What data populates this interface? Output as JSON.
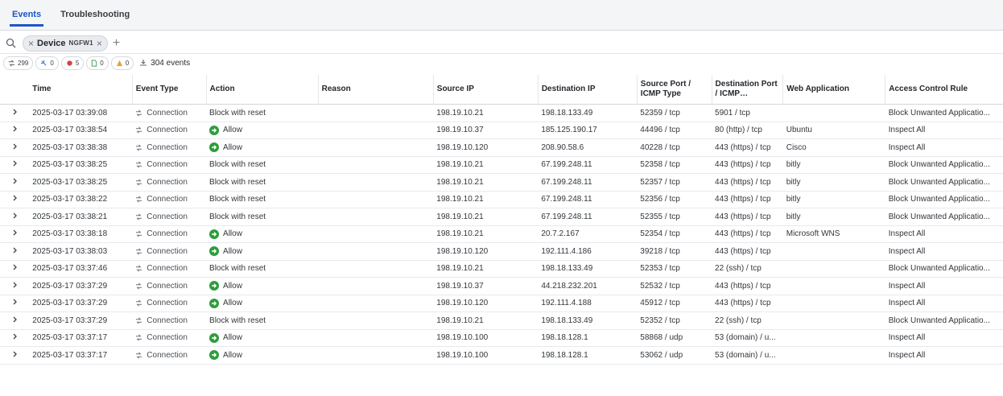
{
  "tabs": [
    {
      "label": "Events",
      "active": true
    },
    {
      "label": "Troubleshooting",
      "active": false
    }
  ],
  "filter": {
    "search_icon": "search-icon",
    "chip_key": "Device",
    "chip_value": "NGFW1",
    "add_icon": "plus-icon"
  },
  "counts": {
    "connection": "299",
    "intrusion": "0",
    "malware": "5",
    "file": "0",
    "security_intel": "0",
    "total": "304 events"
  },
  "columns": [
    "Time",
    "Event Type",
    "Action",
    "Reason",
    "Source IP",
    "Destination IP",
    "Source Port / ICMP Type",
    "Destination Port / ICMP…",
    "Web Application",
    "Access Control Rule"
  ],
  "rows": [
    {
      "time": "2025-03-17 03:39:08",
      "type": "Connection",
      "action": "Block with reset",
      "reason": "",
      "src": "198.19.10.21",
      "dst": "198.18.133.49",
      "sport": "52359 / tcp",
      "dport": "5901 / tcp",
      "app": "",
      "rule": "Block Unwanted Applicatio..."
    },
    {
      "time": "2025-03-17 03:38:54",
      "type": "Connection",
      "action": "Allow",
      "reason": "",
      "src": "198.19.10.37",
      "dst": "185.125.190.17",
      "sport": "44496 / tcp",
      "dport": "80 (http) / tcp",
      "app": "Ubuntu",
      "rule": "Inspect All"
    },
    {
      "time": "2025-03-17 03:38:38",
      "type": "Connection",
      "action": "Allow",
      "reason": "",
      "src": "198.19.10.120",
      "dst": "208.90.58.6",
      "sport": "40228 / tcp",
      "dport": "443 (https) / tcp",
      "app": "Cisco",
      "rule": "Inspect All"
    },
    {
      "time": "2025-03-17 03:38:25",
      "type": "Connection",
      "action": "Block with reset",
      "reason": "",
      "src": "198.19.10.21",
      "dst": "67.199.248.11",
      "sport": "52358 / tcp",
      "dport": "443 (https) / tcp",
      "app": "bitly",
      "rule": "Block Unwanted Applicatio..."
    },
    {
      "time": "2025-03-17 03:38:25",
      "type": "Connection",
      "action": "Block with reset",
      "reason": "",
      "src": "198.19.10.21",
      "dst": "67.199.248.11",
      "sport": "52357 / tcp",
      "dport": "443 (https) / tcp",
      "app": "bitly",
      "rule": "Block Unwanted Applicatio..."
    },
    {
      "time": "2025-03-17 03:38:22",
      "type": "Connection",
      "action": "Block with reset",
      "reason": "",
      "src": "198.19.10.21",
      "dst": "67.199.248.11",
      "sport": "52356 / tcp",
      "dport": "443 (https) / tcp",
      "app": "bitly",
      "rule": "Block Unwanted Applicatio..."
    },
    {
      "time": "2025-03-17 03:38:21",
      "type": "Connection",
      "action": "Block with reset",
      "reason": "",
      "src": "198.19.10.21",
      "dst": "67.199.248.11",
      "sport": "52355 / tcp",
      "dport": "443 (https) / tcp",
      "app": "bitly",
      "rule": "Block Unwanted Applicatio..."
    },
    {
      "time": "2025-03-17 03:38:18",
      "type": "Connection",
      "action": "Allow",
      "reason": "",
      "src": "198.19.10.21",
      "dst": "20.7.2.167",
      "sport": "52354 / tcp",
      "dport": "443 (https) / tcp",
      "app": "Microsoft WNS",
      "rule": "Inspect All"
    },
    {
      "time": "2025-03-17 03:38:03",
      "type": "Connection",
      "action": "Allow",
      "reason": "",
      "src": "198.19.10.120",
      "dst": "192.111.4.186",
      "sport": "39218 / tcp",
      "dport": "443 (https) / tcp",
      "app": "",
      "rule": "Inspect All"
    },
    {
      "time": "2025-03-17 03:37:46",
      "type": "Connection",
      "action": "Block with reset",
      "reason": "",
      "src": "198.19.10.21",
      "dst": "198.18.133.49",
      "sport": "52353 / tcp",
      "dport": "22 (ssh) / tcp",
      "app": "",
      "rule": "Block Unwanted Applicatio..."
    },
    {
      "time": "2025-03-17 03:37:29",
      "type": "Connection",
      "action": "Allow",
      "reason": "",
      "src": "198.19.10.37",
      "dst": "44.218.232.201",
      "sport": "52532 / tcp",
      "dport": "443 (https) / tcp",
      "app": "",
      "rule": "Inspect All"
    },
    {
      "time": "2025-03-17 03:37:29",
      "type": "Connection",
      "action": "Allow",
      "reason": "",
      "src": "198.19.10.120",
      "dst": "192.111.4.188",
      "sport": "45912 / tcp",
      "dport": "443 (https) / tcp",
      "app": "",
      "rule": "Inspect All"
    },
    {
      "time": "2025-03-17 03:37:29",
      "type": "Connection",
      "action": "Block with reset",
      "reason": "",
      "src": "198.19.10.21",
      "dst": "198.18.133.49",
      "sport": "52352 / tcp",
      "dport": "22 (ssh) / tcp",
      "app": "",
      "rule": "Block Unwanted Applicatio..."
    },
    {
      "time": "2025-03-17 03:37:17",
      "type": "Connection",
      "action": "Allow",
      "reason": "",
      "src": "198.19.10.100",
      "dst": "198.18.128.1",
      "sport": "58868 / udp",
      "dport": "53 (domain) / u...",
      "app": "",
      "rule": "Inspect All"
    },
    {
      "time": "2025-03-17 03:37:17",
      "type": "Connection",
      "action": "Allow",
      "reason": "",
      "src": "198.19.10.100",
      "dst": "198.18.128.1",
      "sport": "53062 / udp",
      "dport": "53 (domain) / u...",
      "app": "",
      "rule": "Inspect All"
    }
  ],
  "colors": {
    "accent": "#1c56c8",
    "allow": "#2e9d3c",
    "malware": "#d93f3f",
    "security_intel": "#e6a23c"
  }
}
